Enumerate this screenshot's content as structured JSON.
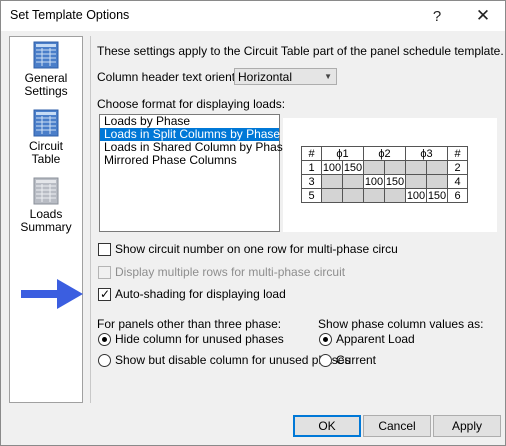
{
  "window": {
    "title": "Set Template Options",
    "help_glyph": "?",
    "close_glyph": "✕"
  },
  "sidebar": {
    "items": [
      {
        "line1": "General",
        "line2": "Settings",
        "icon": "table-icon"
      },
      {
        "line1": "Circuit",
        "line2": "Table",
        "icon": "table-icon"
      },
      {
        "line1": "Loads",
        "line2": "Summary",
        "icon": "table-icon"
      }
    ]
  },
  "panel": {
    "intro": "These settings apply to the Circuit Table part of the panel schedule template.",
    "orientation_label": "Column header text orientation:",
    "orientation_value": "Horizontal",
    "format_label": "Choose format for displaying loads:",
    "format_options": [
      "Loads by Phase",
      "Loads in Split Columns by Phase",
      "Loads in Shared Column by Phase",
      "Mirrored Phase Columns"
    ],
    "selected_format_index": 1,
    "preview": {
      "headers": [
        "#",
        "ϕ1",
        "ϕ2",
        "ϕ3",
        "#"
      ],
      "rows": [
        {
          "left": "1",
          "c": [
            "100",
            "150",
            "",
            "",
            "",
            ""
          ],
          "right": "2"
        },
        {
          "left": "3",
          "c": [
            "",
            "",
            "100",
            "150",
            "",
            ""
          ],
          "right": "4"
        },
        {
          "left": "5",
          "c": [
            "",
            "",
            "",
            "",
            "100",
            "150"
          ],
          "right": "6"
        }
      ]
    },
    "checkbox_circuit_number": {
      "label": "Show circuit number on one row for multi-phase circu",
      "checked": false
    },
    "checkbox_multiple_rows": {
      "label": "Display multiple rows for multi-phase circuit",
      "checked": false,
      "disabled": true
    },
    "checkbox_auto_shading": {
      "label": "Auto-shading for displaying load",
      "checked": true
    },
    "other_phase": {
      "label": "For panels other than three phase:",
      "options": [
        "Hide column for unused phases",
        "Show but disable column for unused phases"
      ],
      "selected_index": 0
    },
    "phase_values": {
      "label": "Show phase column values as:",
      "options": [
        "Apparent Load",
        "Current"
      ],
      "selected_index": 0
    }
  },
  "buttons": {
    "ok": "OK",
    "cancel": "Cancel",
    "apply": "Apply"
  },
  "colors": {
    "selection": "#0078d7",
    "annotation_arrow": "#3b5ee0",
    "shading": "#d4d4d4"
  }
}
